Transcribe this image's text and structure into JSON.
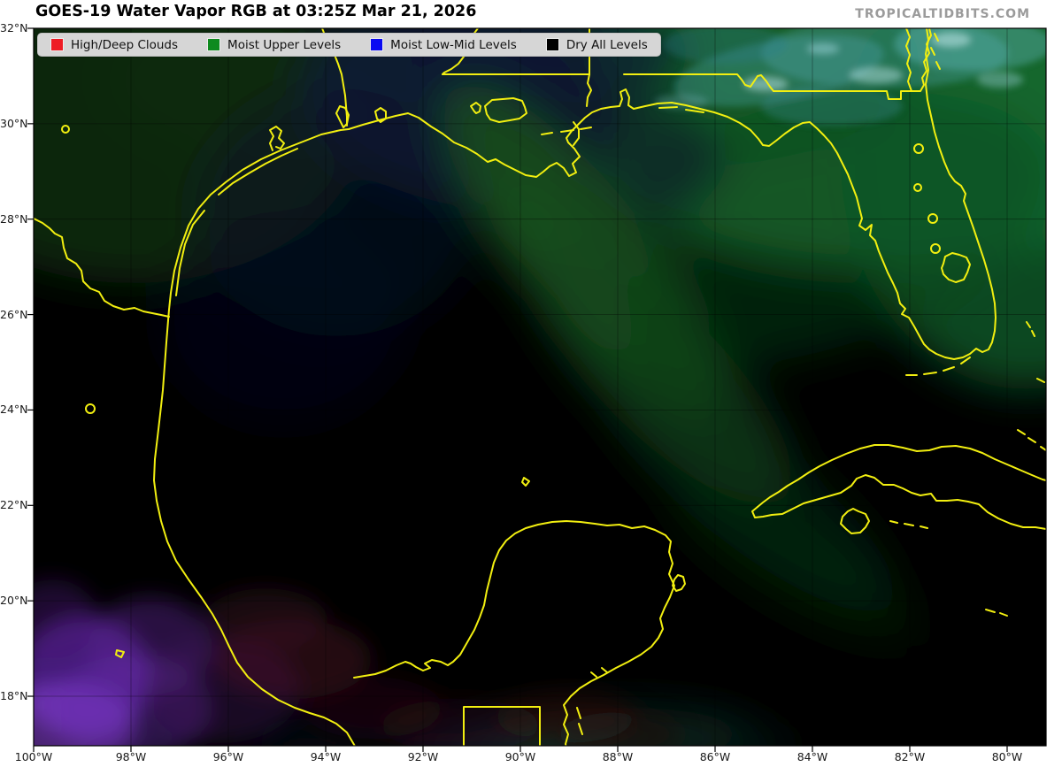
{
  "header": {
    "title": "GOES-19 Water Vapor RGB at 03:25Z Mar 21, 2026",
    "watermark": "TROPICALTIDBITS.COM"
  },
  "legend": {
    "items": [
      {
        "label": "High/Deep Clouds",
        "color": "#ee1c24",
        "icon": "red-swatch"
      },
      {
        "label": "Moist Upper Levels",
        "color": "#0e8a1e",
        "icon": "green-swatch"
      },
      {
        "label": "Moist Low-Mid Levels",
        "color": "#0b0bf2",
        "icon": "blue-swatch"
      },
      {
        "label": "Dry All Levels",
        "color": "#000000",
        "icon": "black-swatch"
      }
    ]
  },
  "axes": {
    "lat_labels": [
      "32°N",
      "30°N",
      "28°N",
      "26°N",
      "24°N",
      "22°N",
      "20°N",
      "18°N"
    ],
    "lon_labels": [
      "100°W",
      "98°W",
      "96°W",
      "94°W",
      "92°W",
      "90°W",
      "88°W",
      "86°W",
      "84°W",
      "82°W",
      "80°W"
    ]
  },
  "map": {
    "coastline_color": "#f2ef10",
    "background_color": "#000000",
    "description": "GOES-19 water vapor RGB satellite image of the Gulf of Mexico: dry (black) air over most of the Gulf, moist upper-level plume (green) over the northeast Gulf and Florida, low-level moisture (purple/blue) over southwest Mexico"
  }
}
